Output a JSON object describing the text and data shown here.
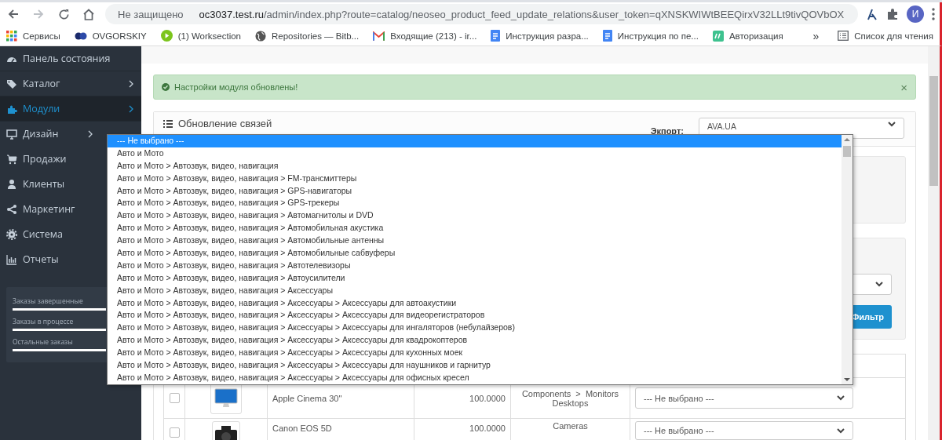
{
  "browser": {
    "forward_disabled": true,
    "security": "Не защищено",
    "url_host": "oc3037.test.ru",
    "url_path": "/admin/index.php?route=catalog/neoseo_product_feed_update_relations&user_token=qXNSKWIWtBEEQirxV32LLt9tivQOVbOX",
    "profile_initial": "И",
    "bookmarks": [
      {
        "kind": "apps",
        "label": "Сервисы"
      },
      {
        "kind": "logo",
        "label": "OVGORSKIY"
      },
      {
        "kind": "play",
        "label": "(1) Worksection"
      },
      {
        "kind": "globe",
        "label": "Repositories — Bitb..."
      },
      {
        "kind": "mail",
        "label": "Входящие (213) - ir..."
      },
      {
        "kind": "doc",
        "label": "Инструкция разра..."
      },
      {
        "kind": "doc",
        "label": "Инструкция по пе..."
      },
      {
        "kind": "tile",
        "label": "Авторизация"
      }
    ],
    "overflow": "»",
    "reading_list": "Список для чтения"
  },
  "sidebar": {
    "items": [
      {
        "kind": "dashboard",
        "label": "Панель состояния",
        "selected": false,
        "has_children": false
      },
      {
        "kind": "tag",
        "label": "Каталог",
        "selected": false,
        "has_children": true
      },
      {
        "kind": "puzzle",
        "label": "Модули",
        "selected": true,
        "has_children": true
      },
      {
        "kind": "monitor",
        "label": "Дизайн",
        "selected": false,
        "has_children": true
      },
      {
        "kind": "cart",
        "label": "Продажи",
        "selected": false,
        "has_children": false
      },
      {
        "kind": "user",
        "label": "Клиенты",
        "selected": false,
        "has_children": false
      },
      {
        "kind": "share",
        "label": "Маркетинг",
        "selected": false,
        "has_children": false
      },
      {
        "kind": "gear",
        "label": "Система",
        "selected": false,
        "has_children": false
      },
      {
        "kind": "chart",
        "label": "Отчеты",
        "selected": false,
        "has_children": false
      }
    ],
    "stats": [
      {
        "label": "Заказы завершенные",
        "level": 1
      },
      {
        "label": "Заказы в процессе",
        "level": 1
      },
      {
        "label": "Остальные заказы",
        "level": 1
      }
    ]
  },
  "alert": {
    "text": "Настройки модуля обновлены!",
    "close": "×"
  },
  "panel": {
    "title": "Обновление связей",
    "export_label": "Экпорт:",
    "export_value": "AVA.UA",
    "filter_button": "Фильтр"
  },
  "table": {
    "rows": [
      {
        "checked": false,
        "kind": "monitor",
        "name": "Apple Cinema 30\"",
        "price": "100.0000",
        "categories": [
          "Components  >  Monitors",
          "Desktops"
        ],
        "mapping": "--- Не выбрано ---"
      },
      {
        "checked": false,
        "kind": "camera",
        "name": "Canon EOS 5D",
        "price": "100.0000",
        "categories": [
          "Cameras"
        ],
        "mapping": "--- Не выбрано ---"
      }
    ]
  },
  "dropdown": {
    "options": [
      {
        "label": "--- Не выбрано ---",
        "selected": true
      },
      {
        "label": "Авто и Мото",
        "selected": false
      },
      {
        "label": "Авто и Мото > Автозвук, видео, навигация",
        "selected": false
      },
      {
        "label": "Авто и Мото > Автозвук, видео, навигация > FM-трансмиттеры",
        "selected": false
      },
      {
        "label": "Авто и Мото > Автозвук, видео, навигация > GPS-навигаторы",
        "selected": false
      },
      {
        "label": "Авто и Мото > Автозвук, видео, навигация > GPS-трекеры",
        "selected": false
      },
      {
        "label": "Авто и Мото > Автозвук, видео, навигация > Автомагнитолы и DVD",
        "selected": false
      },
      {
        "label": "Авто и Мото > Автозвук, видео, навигация > Автомобильная акустика",
        "selected": false
      },
      {
        "label": "Авто и Мото > Автозвук, видео, навигация > Автомобильные антенны",
        "selected": false
      },
      {
        "label": "Авто и Мото > Автозвук, видео, навигация > Автомобильные сабвуферы",
        "selected": false
      },
      {
        "label": "Авто и Мото > Автозвук, видео, навигация > Автотелевизоры",
        "selected": false
      },
      {
        "label": "Авто и Мото > Автозвук, видео, навигация > Автоусилители",
        "selected": false
      },
      {
        "label": "Авто и Мото > Автозвук, видео, навигация > Аксессуары",
        "selected": false
      },
      {
        "label": "Авто и Мото > Автозвук, видео, навигация > Аксессуары > Аксессуары для автоакустики",
        "selected": false
      },
      {
        "label": "Авто и Мото > Автозвук, видео, навигация > Аксессуары > Аксессуары для видеорегистраторов",
        "selected": false
      },
      {
        "label": "Авто и Мото > Автозвук, видео, навигация > Аксессуары > Аксессуары для ингаляторов (небулайзеров)",
        "selected": false
      },
      {
        "label": "Авто и Мото > Автозвук, видео, навигация > Аксессуары > Аксессуары для квадрокоптеров",
        "selected": false
      },
      {
        "label": "Авто и Мото > Автозвук, видео, навигация > Аксессуары > Аксессуары для кухонных моек",
        "selected": false
      },
      {
        "label": "Авто и Мото > Автозвук, видео, навигация > Аксессуары > Аксессуары для наушников и гарнитур",
        "selected": false
      },
      {
        "label": "Авто и Мото > Автозвук, видео, навигация > Аксессуары > Аксессуары для офисных кресел",
        "selected": false
      }
    ]
  }
}
